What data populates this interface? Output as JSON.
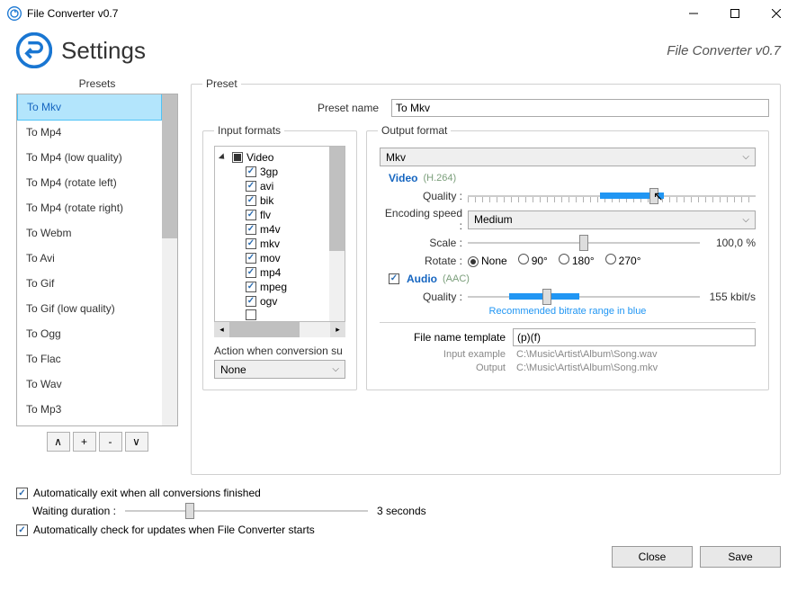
{
  "window": {
    "title": "File Converter v0.7"
  },
  "header": {
    "heading": "Settings",
    "subtitle": "File Converter v0.7"
  },
  "presets": {
    "label": "Presets",
    "items": [
      {
        "label": "To Mkv",
        "selected": true
      },
      {
        "label": "To Mp4"
      },
      {
        "label": "To Mp4 (low quality)"
      },
      {
        "label": "To Mp4 (rotate left)"
      },
      {
        "label": "To Mp4 (rotate right)"
      },
      {
        "label": "To Webm"
      },
      {
        "label": "To Avi"
      },
      {
        "label": "To Gif"
      },
      {
        "label": "To Gif (low quality)"
      },
      {
        "label": "To Ogg"
      },
      {
        "label": "To Flac"
      },
      {
        "label": "To Wav"
      },
      {
        "label": "To Mp3"
      }
    ],
    "btn_up": "∧",
    "btn_add": "+",
    "btn_remove": "-",
    "btn_down": "∨"
  },
  "preset": {
    "legend": "Preset",
    "name_label": "Preset name",
    "name_value": "To Mkv"
  },
  "input_formats": {
    "legend": "Input formats",
    "group": "Video",
    "items": [
      {
        "label": "3gp",
        "checked": true
      },
      {
        "label": "avi",
        "checked": true
      },
      {
        "label": "bik",
        "checked": true
      },
      {
        "label": "flv",
        "checked": true
      },
      {
        "label": "m4v",
        "checked": true
      },
      {
        "label": "mkv",
        "checked": true
      },
      {
        "label": "mov",
        "checked": true
      },
      {
        "label": "mp4",
        "checked": true
      },
      {
        "label": "mpeg",
        "checked": true
      },
      {
        "label": "ogv",
        "checked": true
      }
    ],
    "action_label": "Action when conversion su",
    "action_value": "None"
  },
  "output": {
    "legend": "Output format",
    "format": "Mkv",
    "video_h": "Video",
    "video_codec": "(H.264)",
    "quality_label": "Quality :",
    "enc_speed_label": "Encoding speed :",
    "enc_speed_value": "Medium",
    "scale_label": "Scale :",
    "scale_value": "100,0 %",
    "rotate_label": "Rotate :",
    "rotate_opts": [
      "None",
      "90°",
      "180°",
      "270°"
    ],
    "rotate_selected": 0,
    "audio_h": "Audio",
    "audio_codec": "(AAC)",
    "audio_quality_label": "Quality :",
    "audio_quality_value": "155 kbit/s",
    "reco": "Recommended bitrate range in blue",
    "tpl_label": "File name template",
    "tpl_value": "(p)(f)",
    "input_example_label": "Input example",
    "input_example": "C:\\Music\\Artist\\Album\\Song.wav",
    "output_example_label": "Output",
    "output_example": "C:\\Music\\Artist\\Album\\Song.mkv"
  },
  "options": {
    "auto_exit": "Automatically exit when all conversions finished",
    "wait_label": "Waiting duration :",
    "wait_value": "3 seconds",
    "auto_update": "Automatically check for updates when File Converter starts"
  },
  "footer": {
    "close": "Close",
    "save": "Save"
  }
}
